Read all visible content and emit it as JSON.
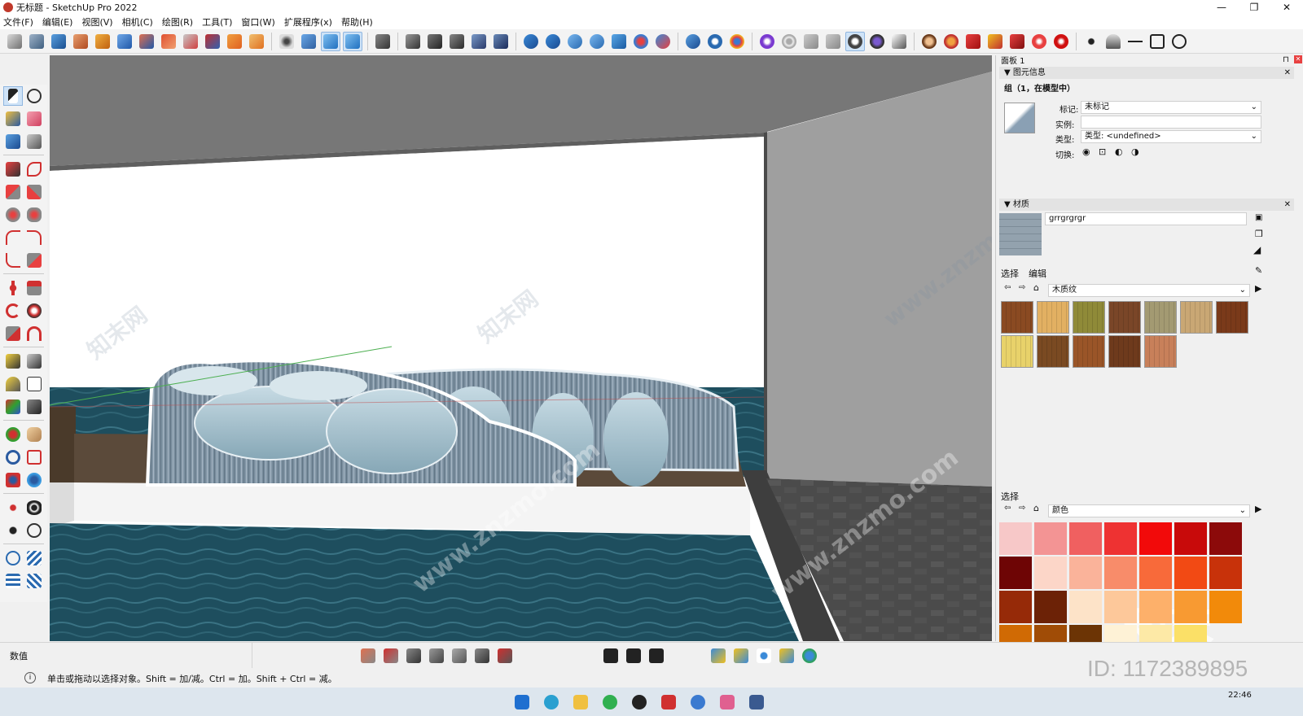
{
  "window": {
    "title": "无标题 - SketchUp Pro 2022",
    "buttons": [
      "—",
      "❐",
      "✕"
    ]
  },
  "menu": [
    "文件(F)",
    "编辑(E)",
    "视图(V)",
    "相机(C)",
    "绘图(R)",
    "工具(T)",
    "窗口(W)",
    "扩展程序(x)",
    "帮助(H)"
  ],
  "tray": {
    "title": "面板 1",
    "entity_info": {
      "header": "▼ 图元信息",
      "selection": "组（1，在模型中）",
      "tag_label": "标记:",
      "tag_value": "未标记",
      "instance_label": "实例:",
      "instance_value": "",
      "type_label": "类型:",
      "type_value": "类型:  <undefined>",
      "toggle_label": "切换:"
    },
    "materials": {
      "header": "▼ 材质",
      "material_name": "grrgrgrgr",
      "tab_select": "选择",
      "tab_edit": "编辑",
      "library": "木质纹",
      "wood_swatches": [
        "#8a4a22",
        "#e2b062",
        "#8f8a38",
        "#7a4628",
        "#a39a72",
        "#c9a774",
        "#7a3a1a",
        "#e8d26a",
        "#7a4a22",
        "#9a5528",
        "#6e3a1c",
        "#c8805a"
      ]
    },
    "colors": {
      "header": "选择",
      "library": "颜色",
      "swatches": [
        "#f7c8c8",
        "#f39494",
        "#f06060",
        "#ee3232",
        "#f20a0a",
        "#c80a0a",
        "#8c0a0a",
        "#6e0505",
        "#fcd6c8",
        "#fab39a",
        "#f88c6a",
        "#f86a3a",
        "#f24a14",
        "#c8320a",
        "#962a08",
        "#6c2206",
        "#fde3c8",
        "#fdc89a",
        "#fdb06a",
        "#f89a32",
        "#f28a0a",
        "#d06a04",
        "#a04c06",
        "#6c3405",
        "#fef2d6",
        "#fde9a6",
        "#fbe067"
      ]
    }
  },
  "bottom": {
    "measure_label": "数值"
  },
  "status": {
    "message": "单击或拖动以选择对象。Shift = 加/减。Ctrl = 加。Shift + Ctrl = 减。"
  },
  "watermark": {
    "id_text": "ID: 1172389895",
    "brand": "知末",
    "site": "www.znzmo.com",
    "site_cn": "知末网"
  },
  "clock": "22:46"
}
